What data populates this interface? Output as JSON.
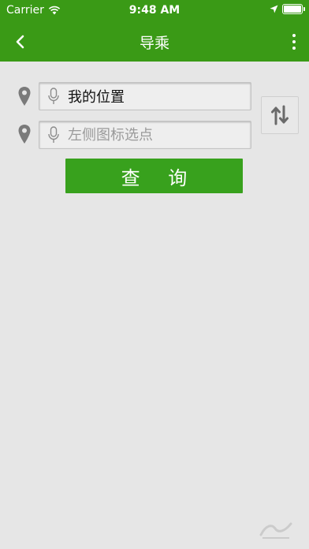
{
  "status_bar": {
    "carrier": "Carrier",
    "time": "9:48 AM"
  },
  "nav": {
    "title": "导乘",
    "back_icon": "chevron-left-icon",
    "more_icon": "more-vertical-icon"
  },
  "form": {
    "origin_value": "我的位置",
    "destination_placeholder": "左侧图标选点",
    "query_label": "查 询",
    "swap_icon": "swap-vertical-icon",
    "pin_icon": "map-pin-icon",
    "mic_icon": "microphone-icon"
  },
  "colors": {
    "header_green": "#3a9a16",
    "button_green": "#38a11d",
    "background": "#e6e6e6"
  }
}
